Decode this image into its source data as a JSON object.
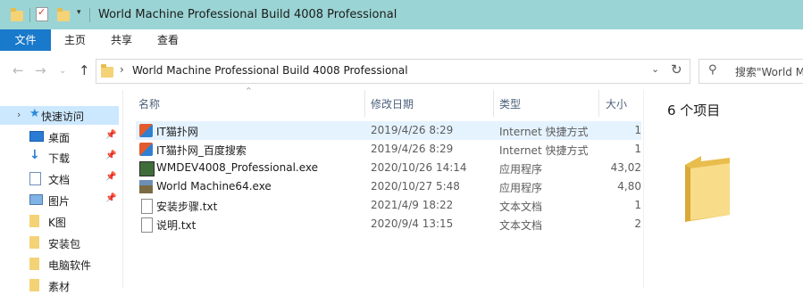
{
  "window": {
    "title": "World Machine Professional Build 4008 Professional",
    "titlebar_color": "#9bd4d4"
  },
  "quick_access_toolbar": {
    "icons": [
      "folder-icon",
      "properties-check-icon",
      "new-folder-icon",
      "customize-dropdown-icon"
    ]
  },
  "ribbon": {
    "tabs": [
      "文件",
      "主页",
      "共享",
      "查看"
    ],
    "file_tab_color": "#1979ca"
  },
  "address": {
    "path": "World Machine Professional Build 4008 Professional",
    "separator": "›"
  },
  "search": {
    "placeholder": "搜索\"World M"
  },
  "sidebar": {
    "items": [
      {
        "label": "快速访问",
        "icon": "star-icon",
        "pinned": false,
        "selected": true
      },
      {
        "label": "桌面",
        "icon": "desktop-icon",
        "pinned": true
      },
      {
        "label": "下载",
        "icon": "download-icon",
        "pinned": true
      },
      {
        "label": "文档",
        "icon": "document-icon",
        "pinned": true
      },
      {
        "label": "图片",
        "icon": "picture-icon",
        "pinned": true
      },
      {
        "label": "K图",
        "icon": "folder-icon",
        "pinned": false
      },
      {
        "label": "安装包",
        "icon": "folder-icon",
        "pinned": false
      },
      {
        "label": "电脑软件",
        "icon": "folder-icon",
        "pinned": false
      },
      {
        "label": "素材",
        "icon": "folder-icon",
        "pinned": false
      }
    ]
  },
  "file_list": {
    "columns": {
      "name": "名称",
      "date": "修改日期",
      "type": "类型",
      "size": "大小"
    },
    "rows": [
      {
        "name": "IT猫扑网",
        "date": "2019/4/26 8:29",
        "type": "Internet 快捷方式",
        "size": "1",
        "icon": "internet-shortcut-icon",
        "highlight": true
      },
      {
        "name": "IT猫扑网_百度搜索",
        "date": "2019/4/26 8:29",
        "type": "Internet 快捷方式",
        "size": "1",
        "icon": "internet-shortcut-icon"
      },
      {
        "name": "WMDEV4008_Professional.exe",
        "date": "2020/10/26 14:14",
        "type": "应用程序",
        "size": "43,02",
        "icon": "installer-icon"
      },
      {
        "name": "World Machine64.exe",
        "date": "2020/10/27 5:48",
        "type": "应用程序",
        "size": "4,80",
        "icon": "world-machine-app-icon"
      },
      {
        "name": "安装步骤.txt",
        "date": "2021/4/9 18:22",
        "type": "文本文档",
        "size": "1",
        "icon": "text-file-icon"
      },
      {
        "name": "说明.txt",
        "date": "2020/9/4 13:15",
        "type": "文本文档",
        "size": "2",
        "icon": "text-file-icon"
      }
    ]
  },
  "details_pane": {
    "item_count": "6 个项目"
  }
}
